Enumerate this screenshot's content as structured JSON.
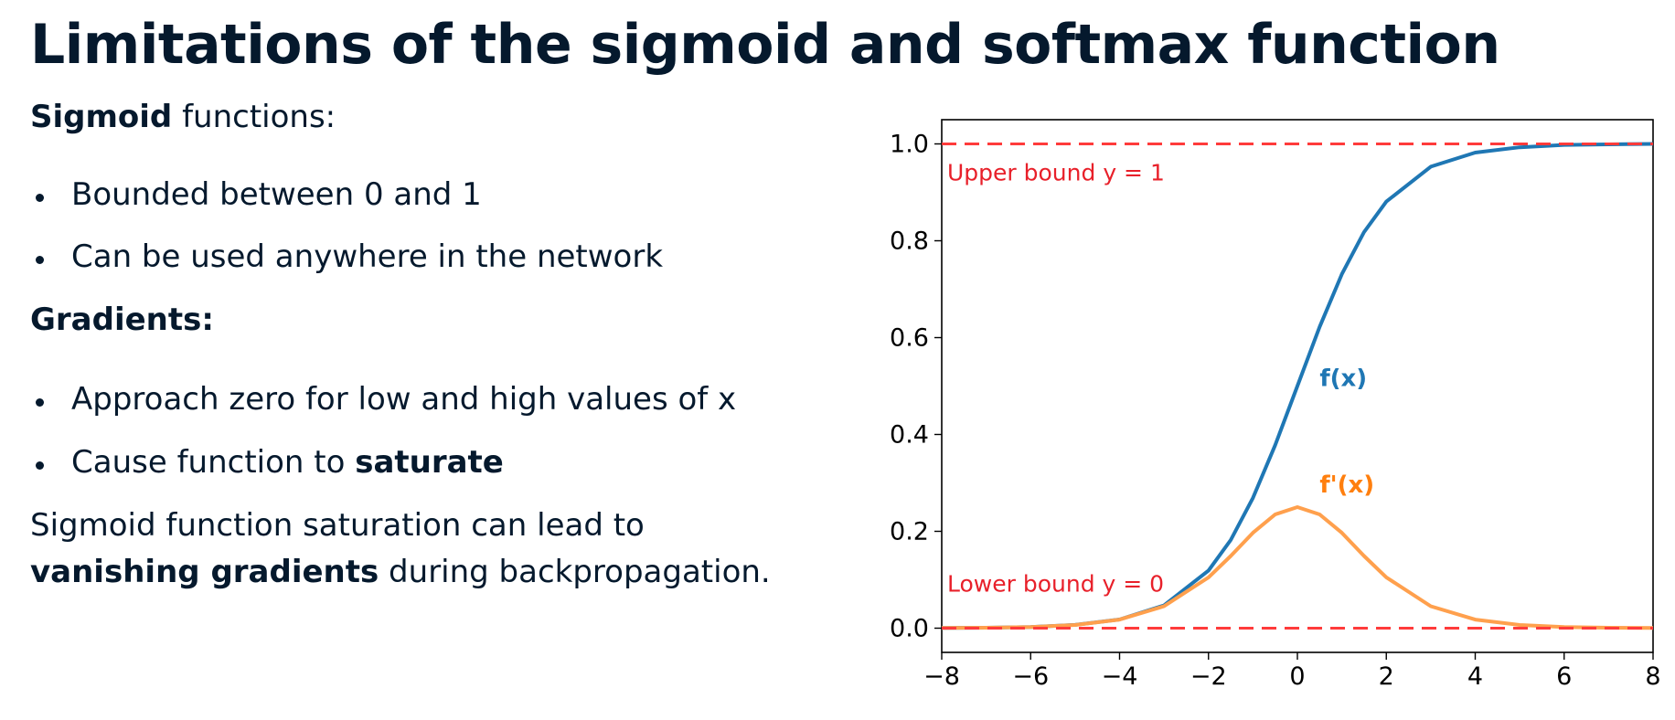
{
  "slide": {
    "title": "Limitations of the sigmoid and softmax function",
    "sigmoid_heading_bold": "Sigmoid",
    "sigmoid_heading_rest": " functions:",
    "sigmoid_bullets": [
      "Bounded between 0 and 1",
      "Can be used anywhere in the network"
    ],
    "gradients_heading": "Gradients:",
    "gradient_bullet_1": "Approach zero for low and high values of x",
    "gradient_bullet_2_prefix": "Cause function to ",
    "gradient_bullet_2_bold": "saturate",
    "conclusion_line1": "Sigmoid function saturation can lead to",
    "conclusion_bold": "vanishing gradients",
    "conclusion_rest": " during backpropagation."
  },
  "chart_data": {
    "type": "line",
    "xlim": [
      -8,
      8
    ],
    "ylim": [
      -0.05,
      1.05
    ],
    "xticks": [
      -8,
      -6,
      -4,
      -2,
      0,
      2,
      4,
      6,
      8
    ],
    "xtick_labels": [
      "−8",
      "−6",
      "−4",
      "−2",
      "0",
      "2",
      "4",
      "6",
      "8"
    ],
    "yticks": [
      0.0,
      0.2,
      0.4,
      0.6,
      0.8,
      1.0
    ],
    "ytick_labels": [
      "0.0",
      "0.2",
      "0.4",
      "0.6",
      "0.8",
      "1.0"
    ],
    "grid": false,
    "series": [
      {
        "name": "f(x)",
        "color": "#1f77b4",
        "x": [
          -8,
          -7,
          -6,
          -5,
          -4,
          -3,
          -2,
          -1.5,
          -1,
          -0.5,
          0,
          0.5,
          1,
          1.5,
          2,
          3,
          4,
          5,
          6,
          7,
          8
        ],
        "values": [
          0.0003,
          0.0009,
          0.0025,
          0.0067,
          0.018,
          0.047,
          0.119,
          0.182,
          0.269,
          0.378,
          0.5,
          0.622,
          0.731,
          0.818,
          0.881,
          0.953,
          0.982,
          0.993,
          0.998,
          0.999,
          1.0
        ]
      },
      {
        "name": "f'(x)",
        "color": "#ffa04d",
        "x": [
          -8,
          -7,
          -6,
          -5,
          -4,
          -3,
          -2,
          -1.5,
          -1,
          -0.5,
          0,
          0.5,
          1,
          1.5,
          2,
          3,
          4,
          5,
          6,
          7,
          8
        ],
        "values": [
          0.0003,
          0.0009,
          0.0025,
          0.0066,
          0.0177,
          0.0452,
          0.105,
          0.149,
          0.197,
          0.235,
          0.25,
          0.235,
          0.197,
          0.149,
          0.105,
          0.0452,
          0.0177,
          0.0066,
          0.0025,
          0.0009,
          0.0003
        ]
      }
    ],
    "reference_lines": [
      {
        "y": 1,
        "label": "Upper bound y = 1",
        "color": "#ff3b3b",
        "style": "dashed"
      },
      {
        "y": 0,
        "label": "Lower bound y = 0",
        "color": "#ff3b3b",
        "style": "dashed"
      }
    ],
    "annotations": [
      {
        "text": "f(x)",
        "x": 0.5,
        "y": 0.5,
        "color": "#1f77b4"
      },
      {
        "text": "f'(x)",
        "x": 0.5,
        "y": 0.28,
        "color": "#ff7f0e"
      }
    ]
  }
}
